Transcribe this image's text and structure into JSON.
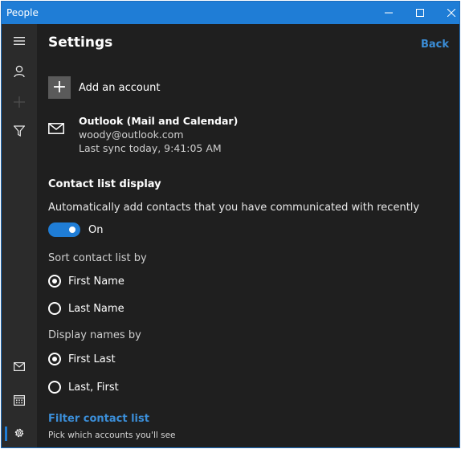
{
  "window": {
    "title": "People"
  },
  "sidebar": {
    "items": [
      {
        "icon": "hamburger-menu-icon"
      },
      {
        "icon": "person-icon"
      },
      {
        "icon": "plus-icon"
      },
      {
        "icon": "filter-icon"
      },
      {
        "icon": "mail-icon"
      },
      {
        "icon": "calendar-icon"
      },
      {
        "icon": "settings-gear-icon"
      }
    ]
  },
  "page": {
    "title": "Settings",
    "back_label": "Back"
  },
  "accounts": {
    "add_label": "Add an account",
    "add_icon": "+",
    "items": [
      {
        "name": "Outlook (Mail and Calendar)",
        "email": "woody@outlook.com",
        "sync": "Last sync today, 9:41:05 AM"
      }
    ]
  },
  "contact_display": {
    "heading": "Contact list display",
    "auto_add_text": "Automatically add contacts that you have communicated with recently",
    "toggle_state": "On",
    "sort_heading": "Sort contact list by",
    "sort_options": [
      {
        "label": "First Name",
        "selected": true
      },
      {
        "label": "Last Name",
        "selected": false
      }
    ],
    "display_heading": "Display names by",
    "display_options": [
      {
        "label": "First Last",
        "selected": true
      },
      {
        "label": "Last, First",
        "selected": false
      }
    ],
    "filter_link": "Filter contact list",
    "filter_desc": "Pick which accounts you'll see"
  },
  "colors": {
    "accent": "#1f7dd6",
    "background": "#1f1f1f",
    "sidebar": "#2b2b2b",
    "link": "#3b8ed8"
  }
}
